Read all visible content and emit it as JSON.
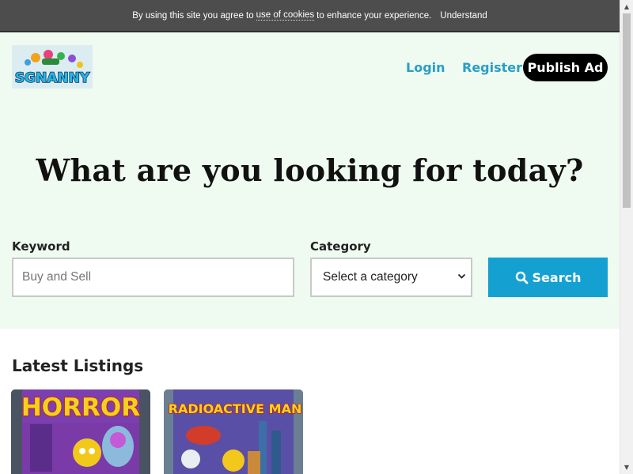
{
  "cookie": {
    "prefix": "By using this site you agree to",
    "link": "use of cookies",
    "suffix": "to enhance your experience.",
    "button": "Understand"
  },
  "header": {
    "logo_text": "SGNANNY",
    "nav": {
      "login": "Login",
      "register": "Register",
      "publish": "Publish Ad"
    }
  },
  "hero": {
    "title": "What are you looking for today?",
    "keyword_label": "Keyword",
    "keyword_placeholder": "Buy and Sell",
    "keyword_value": "",
    "category_label": "Category",
    "category_selected": "Select a category",
    "search_label": "Search"
  },
  "listings": {
    "heading": "Latest Listings",
    "items": [
      {
        "cover_title": "HORROR",
        "icon": "comic-cover-image"
      },
      {
        "cover_title": "RADIOACTIVE MAN",
        "icon": "comic-cover-image"
      }
    ]
  },
  "colors": {
    "hero_bg": "#effaf0",
    "accent": "#14a1d2",
    "link": "#2a9fc4",
    "cookie_bg": "#4d4d4d"
  },
  "icons": {
    "search": "search-icon",
    "select": "chevron-down-icon",
    "scroll_up": "scroll-up-arrow-icon",
    "scroll_down": "scroll-down-arrow-icon"
  }
}
